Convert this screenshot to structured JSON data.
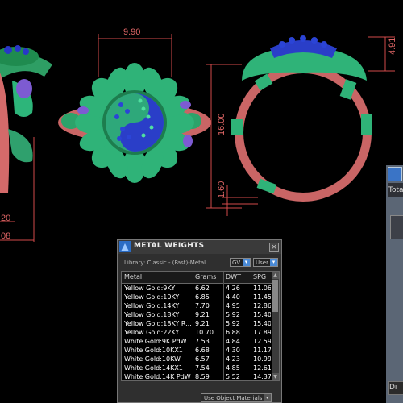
{
  "dimensions": {
    "top_width": "9.90",
    "right_height": "4.91",
    "center_height": "16.00",
    "bottom_small": "1.60",
    "left_a": "20",
    "left_b": "08"
  },
  "metal_weights": {
    "title": "METAL WEIGHTS",
    "library_label": "Library: Classic - (Fast)-Metal",
    "select_gv": "GV",
    "select_user": "User",
    "columns": [
      "Metal",
      "Grams",
      "DWT",
      "SPG"
    ],
    "rows": [
      {
        "metal": "Yellow Gold:9KY",
        "grams": "6.62",
        "dwt": "4.26",
        "spg": "11.06"
      },
      {
        "metal": "Yellow Gold:10KY",
        "grams": "6.85",
        "dwt": "4.40",
        "spg": "11.45"
      },
      {
        "metal": "Yellow Gold:14KY",
        "grams": "7.70",
        "dwt": "4.95",
        "spg": "12.86"
      },
      {
        "metal": "Yellow Gold:18KY",
        "grams": "9.21",
        "spg": "15.40",
        "dwt": "5.92"
      },
      {
        "metal": "Yellow Gold:18KY R...",
        "grams": "9.21",
        "dwt": "5.92",
        "spg": "15.40"
      },
      {
        "metal": "Yellow Gold:22KY",
        "grams": "10.70",
        "dwt": "6.88",
        "spg": "17.89"
      },
      {
        "metal": "White Gold:9K PdW",
        "grams": "7.53",
        "dwt": "4.84",
        "spg": "12.59"
      },
      {
        "metal": "White Gold:10KX1",
        "grams": "6.68",
        "dwt": "4.30",
        "spg": "11.17"
      },
      {
        "metal": "White Gold:10KW",
        "grams": "6.57",
        "dwt": "4.23",
        "spg": "10.99"
      },
      {
        "metal": "White Gold:14KX1",
        "grams": "7.54",
        "dwt": "4.85",
        "spg": "12.61"
      },
      {
        "metal": "White Gold:14K PdW",
        "grams": "8.59",
        "dwt": "5.52",
        "spg": "14.37"
      }
    ],
    "use_object_materials": "Use Object Materials"
  },
  "side_panel": {
    "tab_label": "Tota",
    "bottom_label": "Di"
  }
}
